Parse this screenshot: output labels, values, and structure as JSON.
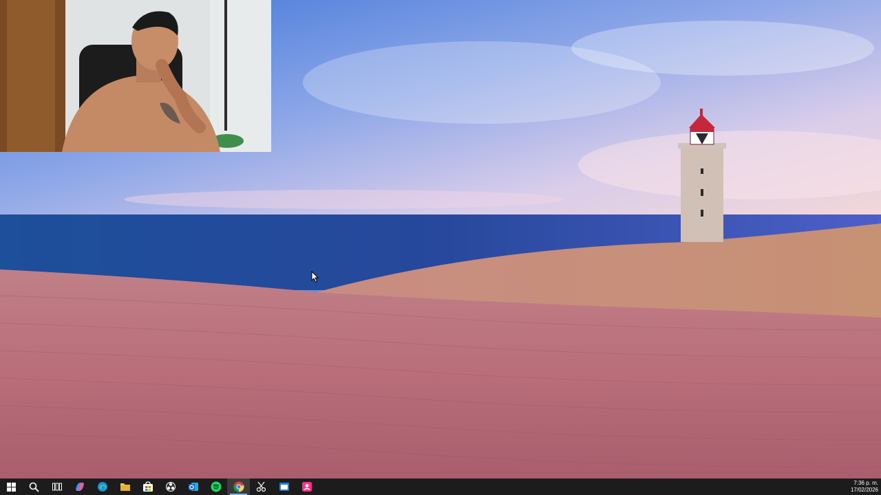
{
  "desktop": {
    "wallpaper_name": "lighthouse-dunes-wallpaper"
  },
  "webcam": {
    "name": "webcam-overlay"
  },
  "taskbar": {
    "icons": [
      {
        "name": "windows-start-icon"
      },
      {
        "name": "search-icon"
      },
      {
        "name": "task-view-icon"
      },
      {
        "name": "copilot-icon"
      },
      {
        "name": "edge-icon"
      },
      {
        "name": "file-explorer-icon"
      },
      {
        "name": "microsoft-store-icon"
      },
      {
        "name": "obs-icon"
      },
      {
        "name": "outlook-icon"
      },
      {
        "name": "spotify-icon"
      },
      {
        "name": "chrome-icon"
      },
      {
        "name": "snipping-tool-icon"
      },
      {
        "name": "app-window-icon"
      },
      {
        "name": "pink-app-icon"
      }
    ],
    "active_icon": "chrome-icon",
    "clock": {
      "time": "7:36 p. m.",
      "date": "17/02/2026"
    }
  },
  "colors": {
    "taskbar_bg": "#1c1c1c",
    "accent": "#76b9ed"
  }
}
